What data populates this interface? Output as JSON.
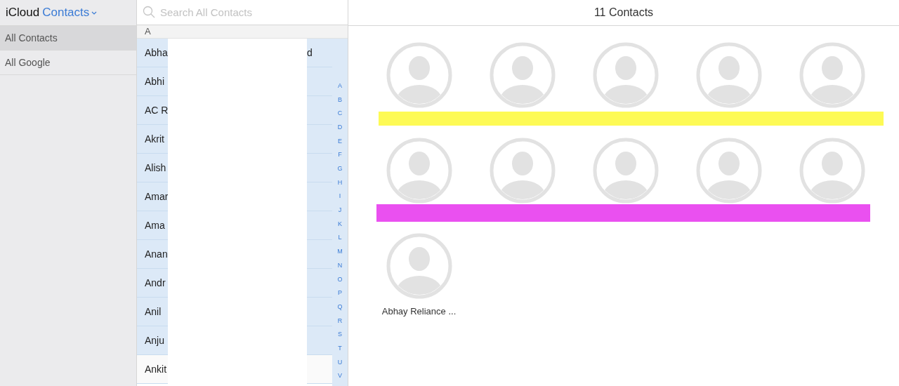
{
  "header": {
    "brand": "iCloud",
    "app": "Contacts"
  },
  "sidebar": {
    "items": [
      {
        "label": "All Contacts",
        "selected": true
      },
      {
        "label": "All Google",
        "selected": false
      }
    ]
  },
  "search": {
    "placeholder": "Search All Contacts"
  },
  "list": {
    "section": "A",
    "rows": [
      {
        "name": "Abha",
        "tail": "d",
        "selected": true
      },
      {
        "name": "Abhi",
        "selected": true
      },
      {
        "name": "AC R",
        "selected": true
      },
      {
        "name": "Akrit",
        "selected": true
      },
      {
        "name": "Alish",
        "selected": true
      },
      {
        "name": "Amar",
        "selected": true
      },
      {
        "name": "Ama",
        "selected": true
      },
      {
        "name": "Anan",
        "selected": true
      },
      {
        "name": "Andr",
        "selected": true
      },
      {
        "name": "Anil",
        "selected": true
      },
      {
        "name": "Anju",
        "selected": true
      },
      {
        "name": "Ankit",
        "selected": false
      }
    ],
    "index": [
      "A",
      "B",
      "C",
      "D",
      "E",
      "F",
      "G",
      "H",
      "I",
      "J",
      "K",
      "L",
      "M",
      "N",
      "O",
      "P",
      "Q",
      "R",
      "S",
      "T",
      "U",
      "V"
    ]
  },
  "main": {
    "title": "11 Contacts",
    "card_rows": [
      {
        "redaction": {
          "color": "#fdfa55"
        },
        "cards": [
          {
            "kind": "avatar"
          },
          {
            "kind": "avatar"
          },
          {
            "kind": "avatar"
          },
          {
            "kind": "avatar"
          },
          {
            "kind": "avatar"
          }
        ]
      },
      {
        "redaction": {
          "color": "#ea50f0"
        },
        "cards": [
          {
            "kind": "avatar"
          },
          {
            "kind": "avatar"
          },
          {
            "kind": "avatar"
          },
          {
            "kind": "avatar"
          },
          {
            "kind": "avatar"
          }
        ]
      },
      {
        "cards": [
          {
            "kind": "avatar",
            "name": "Abhay Reliance ..."
          }
        ]
      }
    ]
  }
}
